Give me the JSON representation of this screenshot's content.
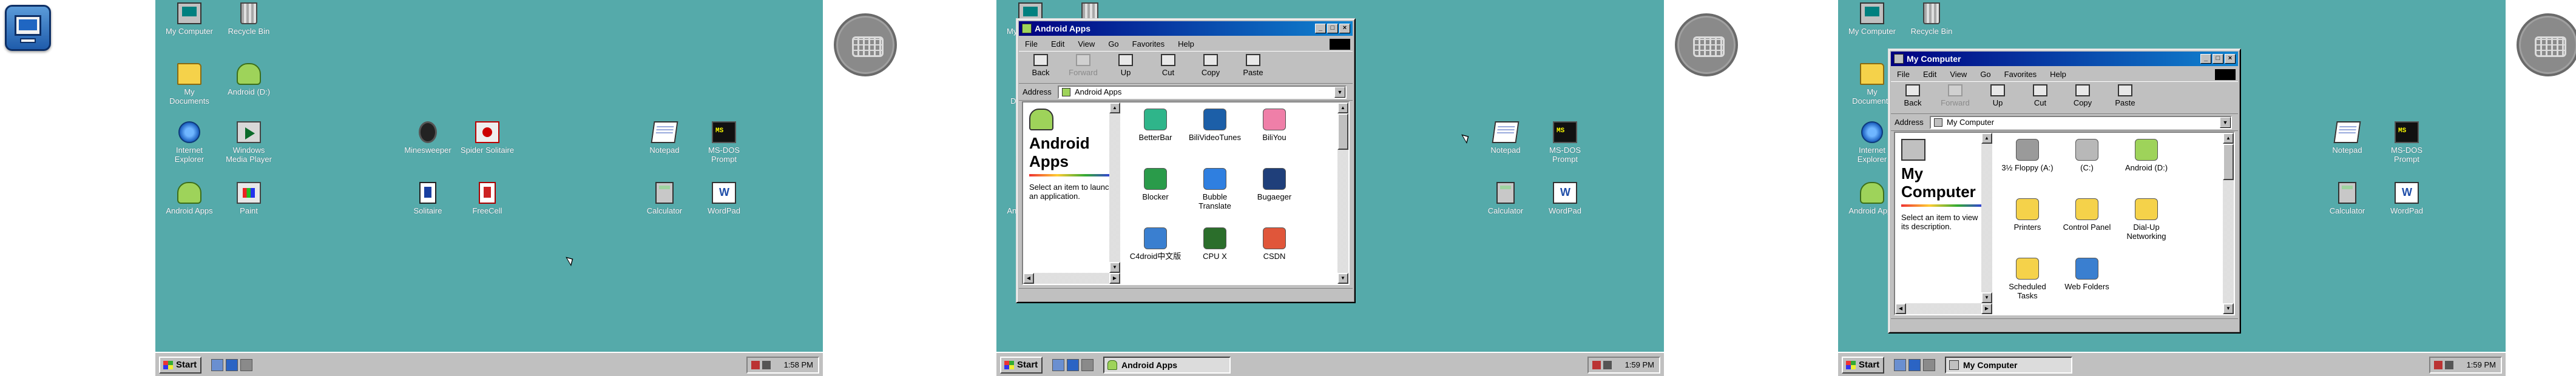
{
  "screens": [
    {
      "desktop_icons": [
        {
          "name": "my-computer",
          "label": "My Computer",
          "glyph": "g-pc"
        },
        {
          "name": "recycle-bin",
          "label": "Recycle Bin",
          "glyph": "g-bin"
        },
        {
          "name": "my-documents",
          "label": "My\nDocuments",
          "glyph": "g-folder"
        },
        {
          "name": "android-d",
          "label": "Android (D:)",
          "glyph": "g-android"
        },
        {
          "name": "internet-explorer",
          "label": "Internet\nExplorer",
          "glyph": "g-ie"
        },
        {
          "name": "windows-media-player",
          "label": "Windows\nMedia Player",
          "glyph": "g-media"
        },
        {
          "name": "minesweeper",
          "label": "Minesweeper",
          "glyph": "g-mine"
        },
        {
          "name": "spider-solitaire",
          "label": "Spider Solitaire",
          "glyph": "g-spider"
        },
        {
          "name": "notepad",
          "label": "Notepad",
          "glyph": "g-note"
        },
        {
          "name": "ms-dos-prompt",
          "label": "MS-DOS\nPrompt",
          "glyph": "g-dos"
        },
        {
          "name": "android-apps",
          "label": "Android Apps",
          "glyph": "g-android"
        },
        {
          "name": "paint",
          "label": "Paint",
          "glyph": "g-paint"
        },
        {
          "name": "solitaire",
          "label": "Solitaire",
          "glyph": "g-card"
        },
        {
          "name": "freecell",
          "label": "FreeCell",
          "glyph": "g-free"
        },
        {
          "name": "calculator",
          "label": "Calculator",
          "glyph": "g-calc"
        },
        {
          "name": "wordpad",
          "label": "WordPad",
          "glyph": "g-word"
        }
      ],
      "taskbar": {
        "start": "Start",
        "task": "",
        "clock": "1:58 PM"
      }
    },
    {
      "window": {
        "title": "Android Apps",
        "menu": [
          "File",
          "Edit",
          "View",
          "Go",
          "Favorites",
          "Help"
        ],
        "toolbar": [
          {
            "label": "Back",
            "disabled": false
          },
          {
            "label": "Forward",
            "disabled": true
          },
          {
            "label": "Up",
            "disabled": false
          },
          {
            "label": "Cut",
            "disabled": false
          },
          {
            "label": "Copy",
            "disabled": false
          },
          {
            "label": "Paste",
            "disabled": false
          }
        ],
        "address_label": "Address",
        "address": "Android Apps",
        "info_title": "Android\nApps",
        "info_desc": "Select an item to launch an application.",
        "items": [
          {
            "label": "BetterBar",
            "color": "#2fb58a"
          },
          {
            "label": "BiliVideoTunes",
            "color": "#1c5fa8"
          },
          {
            "label": "BiliYou",
            "color": "#ef7fa8"
          },
          {
            "label": "Blocker",
            "color": "#2a9b4a"
          },
          {
            "label": "Bubble\nTranslate",
            "color": "#2f7fe0"
          },
          {
            "label": "Bugaeger",
            "color": "#1f3f7a"
          },
          {
            "label": "C4droid中文版",
            "color": "#3a7fd0"
          },
          {
            "label": "CPU X",
            "color": "#2b6e2b"
          },
          {
            "label": "CSDN",
            "color": "#e0563a"
          }
        ]
      },
      "taskbar": {
        "start": "Start",
        "task": "Android Apps",
        "clock": "1:59 PM"
      }
    },
    {
      "window": {
        "title": "My Computer",
        "menu": [
          "File",
          "Edit",
          "View",
          "Go",
          "Favorites",
          "Help"
        ],
        "toolbar": [
          {
            "label": "Back",
            "disabled": false
          },
          {
            "label": "Forward",
            "disabled": true
          },
          {
            "label": "Up",
            "disabled": false
          },
          {
            "label": "Cut",
            "disabled": false
          },
          {
            "label": "Copy",
            "disabled": false
          },
          {
            "label": "Paste",
            "disabled": false
          }
        ],
        "address_label": "Address",
        "address": "My Computer",
        "info_title": "My\nComputer",
        "info_desc": "Select an item to view its description.",
        "items": [
          {
            "label": "3½ Floppy (A:)",
            "color": "#9a9a9a"
          },
          {
            "label": "(C:)",
            "color": "#b8b8b8"
          },
          {
            "label": "Android (D:)",
            "color": "#9ed35a"
          },
          {
            "label": "Printers",
            "color": "#f5d24a"
          },
          {
            "label": "Control Panel",
            "color": "#f5d24a"
          },
          {
            "label": "Dial-Up\nNetworking",
            "color": "#f5d24a"
          },
          {
            "label": "Scheduled\nTasks",
            "color": "#f5d24a"
          },
          {
            "label": "Web Folders",
            "color": "#3a7fd0"
          }
        ]
      },
      "taskbar": {
        "start": "Start",
        "task": "My Computer",
        "clock": "1:59 PM"
      }
    }
  ]
}
